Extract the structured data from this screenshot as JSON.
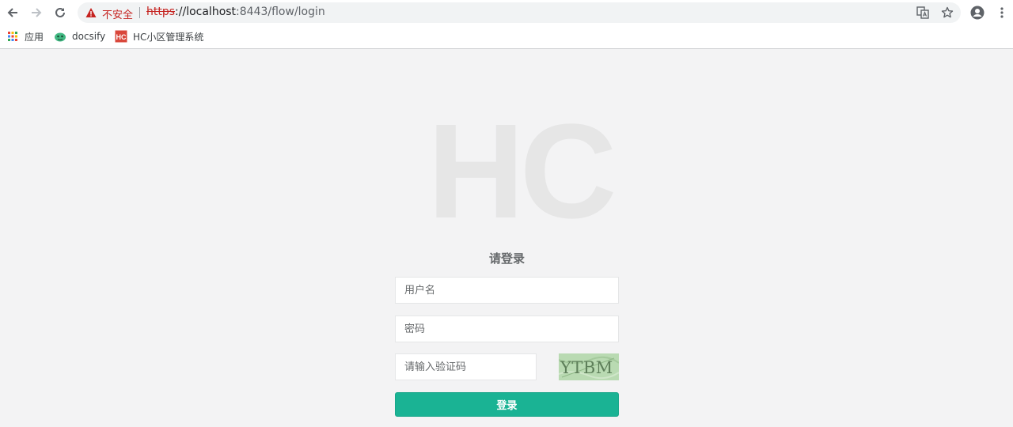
{
  "browser": {
    "security_label": "不安全",
    "url": {
      "scheme": "https",
      "host": "://localhost",
      "rest": ":8443/flow/login"
    },
    "icons": [
      "back-icon",
      "forward-icon",
      "reload-icon",
      "warning-icon",
      "translate-icon",
      "star-icon",
      "profile-icon",
      "menu-icon"
    ]
  },
  "bookmarks": [
    {
      "label": "应用",
      "icon": "apps-grid-icon"
    },
    {
      "label": "docsify",
      "icon": "docsify-icon"
    },
    {
      "label": "HC小区管理系统",
      "icon": "hc-logo-icon"
    }
  ],
  "login": {
    "logo_text": "HC",
    "heading": "请登录",
    "username_placeholder": "用户名",
    "password_placeholder": "密码",
    "captcha_placeholder": "请输入验证码",
    "captcha_text": "YTBM",
    "submit_label": "登录"
  },
  "colors": {
    "accent": "#1ab394",
    "page_background": "#f3f3f4",
    "insecure": "#c5221f",
    "logo": "#e6e6e6"
  }
}
